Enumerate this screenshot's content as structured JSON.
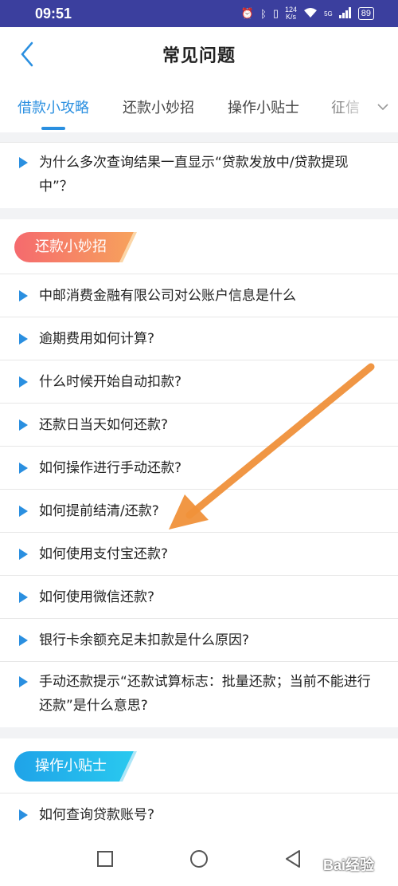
{
  "status": {
    "time": "09:51",
    "net_speed_value": "124",
    "net_speed_unit": "K/s",
    "signal_label": "5G",
    "battery": "89"
  },
  "header": {
    "title": "常见问题"
  },
  "tabs": [
    {
      "label": "借款小攻略",
      "active": true
    },
    {
      "label": "还款小妙招",
      "active": false
    },
    {
      "label": "操作小贴士",
      "active": false
    },
    {
      "label": "征信",
      "active": false
    }
  ],
  "sections": {
    "top": {
      "items": [
        "为什么多次查询结果一直显示“贷款发放中/贷款提现中”？"
      ]
    },
    "repayment": {
      "title": "还款小妙招",
      "items": [
        "中邮消费金融有限公司对公账户信息是什么",
        "逾期费用如何计算?",
        "什么时候开始自动扣款?",
        "还款日当天如何还款?",
        "如何操作进行手动还款?",
        "如何提前结清/还款?",
        "如何使用支付宝还款?",
        "如何使用微信还款?",
        "银行卡余额充足未扣款是什么原因?",
        "手动还款提示“还款试算标志：批量还款；当前不能进行还款”是什么意思?"
      ]
    },
    "tips": {
      "title": "操作小贴士",
      "items": [
        "如何查询贷款账号?"
      ]
    }
  },
  "watermark": "Bai经验",
  "colors": {
    "accent": "#2a8fe0",
    "arrow": "#f0913a",
    "statusbar": "#3b3f9e"
  }
}
